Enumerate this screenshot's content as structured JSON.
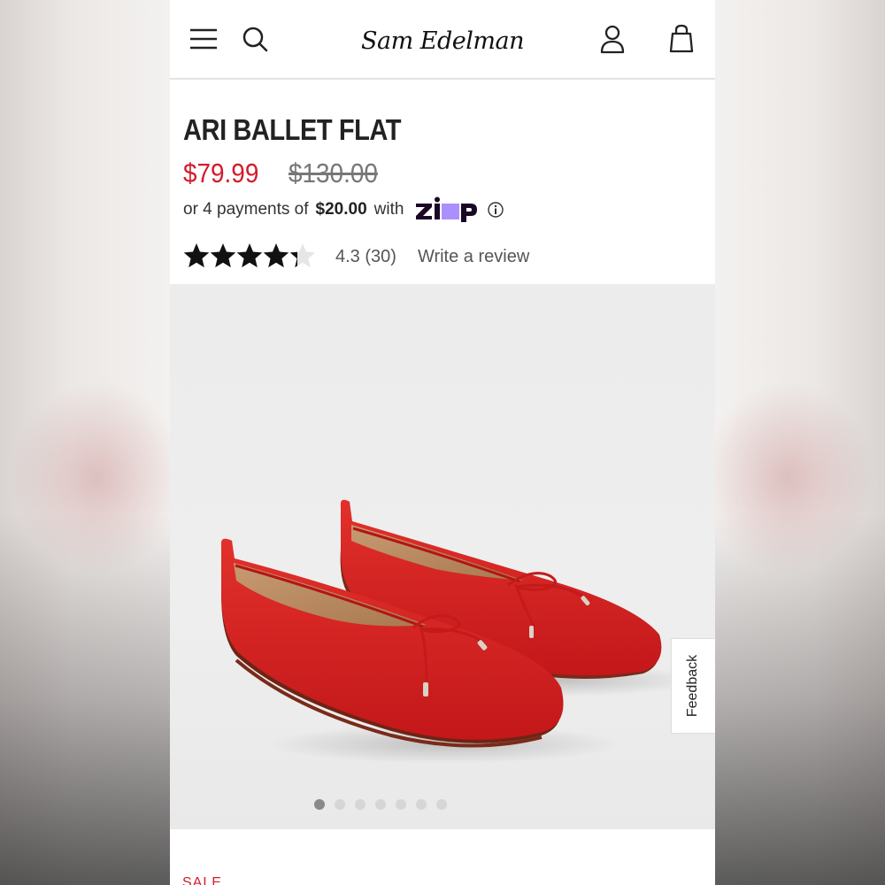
{
  "header": {
    "brand": "Sam Edelman",
    "menu_icon": "hamburger-menu-icon",
    "search_icon": "search-icon",
    "account_icon": "user-icon",
    "bag_icon": "shopping-bag-icon"
  },
  "product": {
    "title": "ARI BALLET FLAT",
    "sale_price": "$79.99",
    "original_price": "$130.00",
    "installment_prefix": "or 4 payments of",
    "installment_amount": "$20.00",
    "installment_suffix": "with",
    "installment_provider": "zip",
    "rating_value": 4.3,
    "rating_label": "4.3 (30)",
    "write_review": "Write a review"
  },
  "gallery": {
    "image_count": 7,
    "active_index": 0,
    "feedback_label": "Feedback"
  },
  "below": {
    "tag": "SALE"
  },
  "colors": {
    "sale_red": "#d41b2c",
    "shoe_red": "#d8211f",
    "zip_purple": "#aa8fff",
    "zip_dark": "#1a0826"
  }
}
